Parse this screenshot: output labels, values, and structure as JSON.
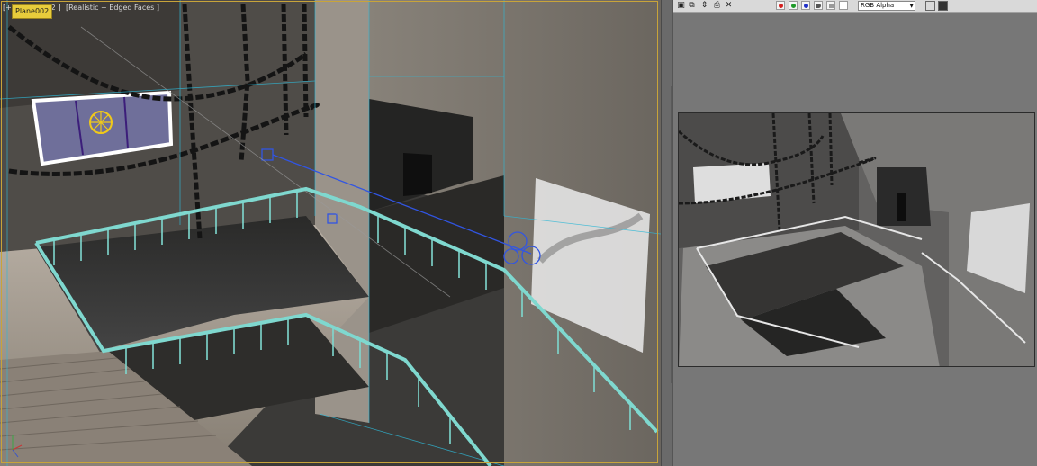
{
  "viewport": {
    "label_left": "[+]",
    "label_tail": "002 ]",
    "label_mode": "[Realistic + Edged Faces ]",
    "selected_tooltip": "Plane002"
  },
  "frame_buffer": {
    "toolbar_icons": [
      "save-image-icon",
      "copy-image-icon",
      "clone-window-icon",
      "print-image-icon",
      "clear-icon"
    ],
    "channel_toggles": [
      {
        "name": "red-channel",
        "color": "#d42020"
      },
      {
        "name": "green-channel",
        "color": "#1f9a2a"
      },
      {
        "name": "blue-channel",
        "color": "#2030c8"
      },
      {
        "name": "alpha-channel",
        "color": "#555555"
      },
      {
        "name": "mono-channel",
        "color": "#999999"
      }
    ],
    "channel_select": "RGB Alpha"
  },
  "colors": {
    "viewport_frame": "#c8a43a",
    "railing": "#7fd8cf",
    "edges": "#2fb8d6",
    "tooltip": "#e8cc3b"
  }
}
